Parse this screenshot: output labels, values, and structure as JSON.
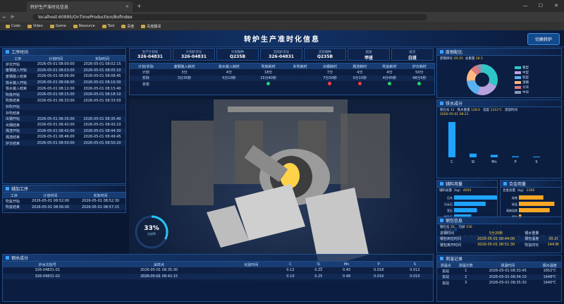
{
  "browser": {
    "tab_title": "转炉生产准时化信息",
    "url": "localhost:60995/OnTimeProduction/BofIndex",
    "bookmarks": [
      "Code",
      "Video",
      "Game",
      "Resource",
      "Tool",
      "百度",
      "百度翻译"
    ]
  },
  "header": {
    "title": "转炉生产准时化信息",
    "switch_button": "切换转炉"
  },
  "process_time": {
    "title": "工序时间",
    "columns": [
      "工序",
      "计划时间",
      "实际时间"
    ],
    "rows": [
      [
        "炉次开始",
        "2026-05-01 08:00:00",
        "2026-05-01 08:02:15"
      ],
      [
        "废钢装入开始",
        "2026-05-01 08:03:00",
        "2026-05-01 08:05:10"
      ],
      [
        "废钢装入结束",
        "2026-05-01 08:06:00",
        "2026-05-01 08:08:45"
      ],
      [
        "铁水装入开始",
        "2026-05-01 08:08:00",
        "2026-05-01 08:10:30"
      ],
      [
        "铁水装入结束",
        "2026-05-01 08:12:00",
        "2026-05-01 08:15:40"
      ],
      [
        "吹炼开始",
        "2026-05-01 08:15:00",
        "2026-05-01 08:18:10"
      ],
      [
        "吹炼结束",
        "2026-05-01 08:33:00",
        "2026-05-01 08:33:50"
      ],
      [
        "补吹开始",
        "",
        ""
      ],
      [
        "补吹结束",
        "",
        ""
      ],
      [
        "出钢开始",
        "2026-05-01 08:35:00",
        "2026-05-01 08:35:40"
      ],
      [
        "出钢结束",
        "2026-05-01 08:42:00",
        "2026-05-01 08:43:10"
      ],
      [
        "溅渣开始",
        "2026-05-01 08:42:00",
        "2026-05-01 08:44:30"
      ],
      [
        "溅渣结束",
        "2026-05-01 08:46:00",
        "2026-05-01 08:49:45"
      ],
      [
        "炉次结束",
        "2026-05-01 08:50:00",
        "2026-05-01 08:50:20"
      ]
    ]
  },
  "aux_process": {
    "title": "辅加工序",
    "columns": [
      "工序",
      "计划时间",
      "实际时间"
    ],
    "rows": [
      [
        "吹氩开始",
        "2026-05-01 08:52:00",
        "2026-05-01 08:52:30"
      ],
      [
        "吹氩结束",
        "2026-05-01 08:56:00",
        "2026-05-01 08:57:15"
      ]
    ]
  },
  "info_boxes": [
    {
      "label": "生产计划号",
      "value": "326-04831"
    },
    {
      "label": "计划炉次号",
      "value": "326-04831"
    },
    {
      "label": "计划钢种",
      "value": "Q235B"
    },
    {
      "label": "实际炉次号",
      "value": "326-04831"
    },
    {
      "label": "实际钢种",
      "value": "Q235B"
    },
    {
      "label": "班组",
      "value": "甲班"
    },
    {
      "label": "班次",
      "value": "白班"
    }
  ],
  "plan_table": {
    "columns": [
      "计划/实际",
      "废钢装入耗时",
      "铁水装入耗时",
      "吹炼耗时",
      "补吹耗时",
      "出钢耗时",
      "溅渣耗时",
      "吹氩耗时",
      "炉次耗时"
    ],
    "rows": [
      [
        "计划",
        "3分",
        "4分",
        "18分",
        "",
        "7分",
        "4分",
        "4分",
        "50分"
      ],
      [
        "实际",
        "3分35秒",
        "5分10秒",
        "15分40秒",
        "",
        "7分30秒",
        "5分15秒",
        "4分45秒",
        "48分5秒"
      ]
    ],
    "status_label": "状态",
    "status": [
      "",
      "",
      "green",
      "",
      "red",
      "red",
      "green",
      "green"
    ]
  },
  "scene": {
    "percent": "33%",
    "percent_sub": "达成率",
    "caption": "废钢装入偏差"
  },
  "molten_iron_section": {
    "title": "钢水成分",
    "columns": [
      "炉水次批号",
      "采样点",
      "化验时间",
      "C",
      "Si",
      "Mn",
      "P",
      "S"
    ],
    "rows": [
      [
        "326-04831-01",
        "2026-05-01 08:35:30",
        "",
        "0.12",
        "0.22",
        "0.45",
        "0.018",
        "0.012"
      ],
      [
        "326-04831-02",
        "2026-05-01 08:42:15",
        "",
        "0.10",
        "0.25",
        "0.48",
        "0.016",
        "0.010"
      ]
    ]
  },
  "scrap_ratio": {
    "title": "废钢配比",
    "summary_label": "废钢牌号",
    "summary_value": "OS 05",
    "total_label": "总重量",
    "total_value": "28.5",
    "legend": [
      "重型",
      "中型",
      "轻型",
      "渣钢",
      "大块",
      "中块"
    ],
    "colors": [
      "#2ec7c9",
      "#b6a2de",
      "#5ab1ef",
      "#ffb980",
      "#d87a80",
      "#8d98b3"
    ],
    "values": [
      12,
      9,
      7,
      5,
      3,
      2
    ]
  },
  "hot_metal": {
    "title": "铁水成分",
    "summary": [
      [
        "铁包号",
        "12"
      ],
      [
        "铁水重量",
        "128.6"
      ],
      [
        "温度",
        "1312℃"
      ],
      [
        "测温时间",
        ""
      ]
    ],
    "date": "2026-05-01 08:21",
    "categories": [
      "C",
      "Si",
      "Mn",
      "P",
      "S"
    ],
    "values": [
      4.3,
      0.45,
      0.3,
      0.12,
      0.03
    ]
  },
  "aux_material": {
    "title": "辅料用量",
    "total_label": "辅料总量（kg）",
    "total_value": "4650",
    "categories": [
      "石灰",
      "白云石",
      "萤石",
      "铁矿石",
      "轻烧白云石",
      "烧结矿"
    ],
    "values": [
      1800,
      1100,
      800,
      600,
      250,
      100
    ],
    "axis": [
      "0",
      "200",
      "400",
      "600",
      "800",
      "1000",
      "1200",
      "1400"
    ]
  },
  "alloy": {
    "title": "合金用量",
    "total_label": "合金总量（kg）",
    "total_value": "2360",
    "categories": [
      "硅铁",
      "硅锰",
      "高碳锰铁",
      "铝块"
    ],
    "values": [
      620,
      900,
      780,
      60
    ],
    "axis": [
      "0",
      "200",
      "400",
      "600",
      "800",
      "1000"
    ]
  },
  "ladle_info": {
    "title": "钢包信息",
    "fields": [
      [
        "钢包号",
        "26"
      ],
      [
        "包龄",
        "156"
      ]
    ],
    "rows": [
      [
        "进钢时间",
        "5分20秒",
        "钢水重量",
        ""
      ],
      [
        "钢包到位时间",
        "2026-05-01 08:44:00",
        "钢包温度",
        "30.2t"
      ],
      [
        "钢包离开时间",
        "2026-05-01 08:51:30",
        "吹氩时长",
        "144.8t"
      ]
    ]
  },
  "temp_record": {
    "title": "测温记录",
    "columns": [
      "测温点",
      "测温次数",
      "测温时间",
      "钢水温度"
    ],
    "rows": [
      [
        "氩站",
        "1",
        "2026-05-01 08:33:45",
        "1652℃"
      ],
      [
        "氩站",
        "2",
        "2026-05-01 08:34:10",
        "1648℃"
      ],
      [
        "氩站",
        "3",
        "2026-05-01 08:35:30",
        "1640℃"
      ]
    ]
  }
}
